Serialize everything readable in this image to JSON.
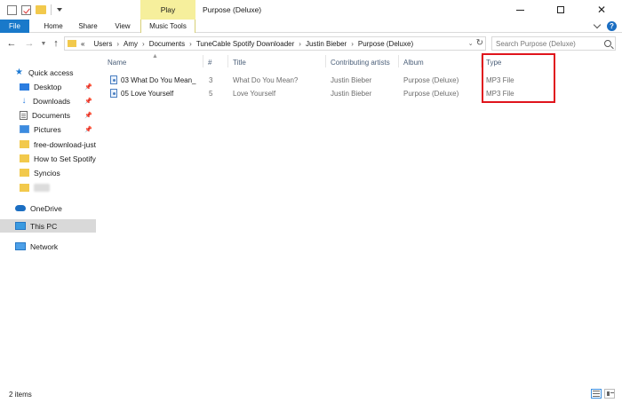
{
  "title_bar": {
    "contextual_tab": "Play",
    "window_title": "Purpose (Deluxe)"
  },
  "ribbon": {
    "tabs": [
      "File",
      "Home",
      "Share",
      "View",
      "Music Tools"
    ]
  },
  "address_bar": {
    "prefix": "«",
    "crumbs": [
      "Users",
      "Amy",
      "Documents",
      "TuneCable Spotify Downloader",
      "Justin Bieber",
      "Purpose (Deluxe)"
    ]
  },
  "search": {
    "placeholder": "Search Purpose (Deluxe)"
  },
  "sidebar": {
    "items": [
      {
        "label": "Quick access",
        "icon": "star-icon"
      },
      {
        "label": "Desktop",
        "icon": "desktop-icon",
        "pinned": true
      },
      {
        "label": "Downloads",
        "icon": "download-icon",
        "pinned": true
      },
      {
        "label": "Documents",
        "icon": "document-icon",
        "pinned": true
      },
      {
        "label": "Pictures",
        "icon": "pictures-icon",
        "pinned": true
      },
      {
        "label": "free-download-just",
        "icon": "folder-icon"
      },
      {
        "label": "How to Set Spotify I",
        "icon": "folder-icon"
      },
      {
        "label": "Syncios",
        "icon": "folder-icon"
      },
      {
        "label": "",
        "icon": "folder-icon"
      },
      {
        "label": "OneDrive",
        "icon": "onedrive-icon"
      },
      {
        "label": "This PC",
        "icon": "pc-icon"
      },
      {
        "label": "Network",
        "icon": "network-icon"
      }
    ]
  },
  "file_list": {
    "columns": [
      "Name",
      "#",
      "Title",
      "Contributing artists",
      "Album",
      "Type"
    ],
    "rows": [
      {
        "name": "03 What Do You Mean_",
        "number": "3",
        "title": "What Do You Mean?",
        "artist": "Justin Bieber",
        "album": "Purpose (Deluxe)",
        "type": "MP3 File"
      },
      {
        "name": "05 Love Yourself",
        "number": "5",
        "title": "Love Yourself",
        "artist": "Justin Bieber",
        "album": "Purpose (Deluxe)",
        "type": "MP3 File"
      }
    ]
  },
  "status_bar": {
    "item_count": "2 items"
  },
  "colors": {
    "accent": "#1979ca",
    "play_tab": "#f6ef9c",
    "highlight": "#e0141c",
    "selected_row": "#d9d9d9"
  }
}
